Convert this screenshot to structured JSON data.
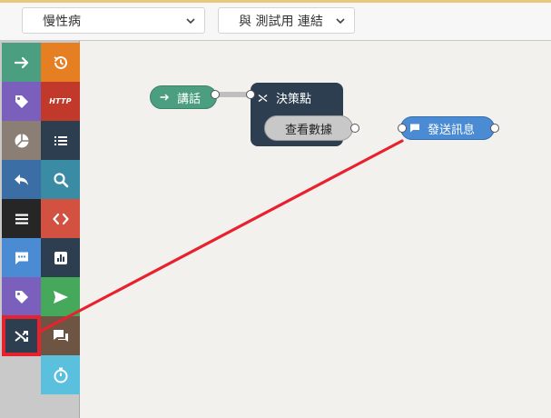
{
  "toolbar": {
    "project_select": "慢性病",
    "connection_select": "與 測試用 連結"
  },
  "palette": {
    "tiles": [
      {
        "icon": "arrow-right-icon",
        "color": "#4c9e80"
      },
      {
        "icon": "history-icon",
        "color": "#e67e22"
      },
      {
        "icon": "tag-icon",
        "color": "#7b5fbc"
      },
      {
        "icon": "http-icon",
        "label": "HTTP",
        "color": "#c0392b"
      },
      {
        "icon": "pie-chart-icon",
        "color": "#8b7e74"
      },
      {
        "icon": "list-icon",
        "color": "#2d3e50"
      },
      {
        "icon": "reply-icon",
        "color": "#3a6ea5"
      },
      {
        "icon": "search-icon",
        "color": "#3a8ca5"
      },
      {
        "icon": "menu-icon",
        "color": "#262626"
      },
      {
        "icon": "code-icon",
        "color": "#d35140"
      },
      {
        "icon": "comment-dots-icon",
        "color": "#4a8bd4"
      },
      {
        "icon": "bar-chart-icon",
        "color": "#2d3e50"
      },
      {
        "icon": "tag-icon",
        "color": "#7b5fbc"
      },
      {
        "icon": "send-icon",
        "color": "#46a85a"
      },
      {
        "icon": "shuffle-icon",
        "color": "#2d3e50"
      },
      {
        "icon": "comments-icon",
        "color": "#6d5443"
      },
      {
        "icon": "stopwatch-icon",
        "color": "#5bc0de"
      }
    ]
  },
  "nodes": {
    "speak": {
      "label": "講話",
      "color": "#4c9e80"
    },
    "decision": {
      "label": "決策點",
      "option": "查看數據",
      "color": "#2d3e50"
    },
    "send_message": {
      "label": "發送訊息",
      "color": "#4a8bd4"
    }
  },
  "annotation": {
    "color": "#e8212f"
  }
}
